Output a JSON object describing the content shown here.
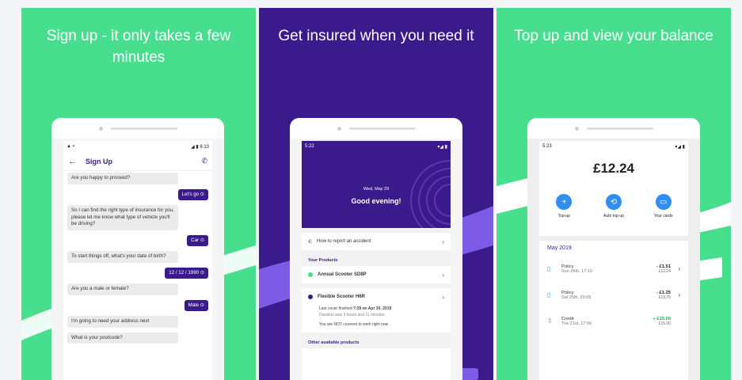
{
  "panels": [
    {
      "headline": "Sign up - it only takes a few minutes",
      "status_time": "6:10",
      "appbar_title": "Sign Up",
      "messages": [
        {
          "from": "bot",
          "text": "Are you happy to proceed?"
        },
        {
          "from": "user",
          "text": "Let's go ⊙"
        },
        {
          "from": "bot",
          "text": "So I can find the right type of insurance for you, please let me know what type of vehicle you'll be driving?"
        },
        {
          "from": "user",
          "text": "Car ⊙"
        },
        {
          "from": "bot",
          "text": "To start things off, what's your date of birth?"
        },
        {
          "from": "user",
          "text": "12 / 12 / 1990 ⊙"
        },
        {
          "from": "bot",
          "text": "Are you a male or female?"
        },
        {
          "from": "user",
          "text": "Male ⊙"
        },
        {
          "from": "bot",
          "text": "I'm going to need your address next"
        },
        {
          "from": "bot",
          "text": "What is your postcode?"
        }
      ]
    },
    {
      "headline": "Get insured when you need it",
      "status_time": "5:22",
      "date": "Wed, May 29",
      "greeting": "Good evening!",
      "report_accident": "How to report an accident",
      "products_label": "Your Products",
      "product1": "Annual Scooter SD8P",
      "product2": "Flexible Scooter H6R",
      "last_cover_prefix": "Last cover finished",
      "last_cover_value": "7:39 on Apr 30, 2019",
      "duration": "Duration was 3 hours and 11 minutes",
      "not_covered": "You are NOT covered to work right now",
      "other_label": "Other available products"
    },
    {
      "headline": "Top up and view your balance",
      "status_time": "5:23",
      "balance": "£12.24",
      "actions": [
        {
          "label": "Top-up",
          "icon": "+"
        },
        {
          "label": "Auto top-up",
          "icon": "⟲"
        },
        {
          "label": "Your cards",
          "icon": "▭"
        }
      ],
      "month": "May 2019",
      "transactions": [
        {
          "title": "Policy",
          "date": "Sun 26th, 17:10",
          "amount": "- £1.51",
          "balance": "£12.24",
          "icon": "▯",
          "positive": false,
          "chevron": true
        },
        {
          "title": "Policy",
          "date": "Sat 25th, 20:09",
          "amount": "- £1.25",
          "balance": "£13.75",
          "icon": "▯",
          "positive": false,
          "chevron": true
        },
        {
          "title": "Credit",
          "date": "Tue 21st, 17:06",
          "amount": "+ £15.00",
          "balance": "£15.00",
          "icon": "⇧",
          "positive": true,
          "chevron": false
        }
      ]
    }
  ],
  "colors": {
    "green": "#47df8e",
    "purple": "#3b1a8c",
    "blue": "#2f8ef0"
  }
}
